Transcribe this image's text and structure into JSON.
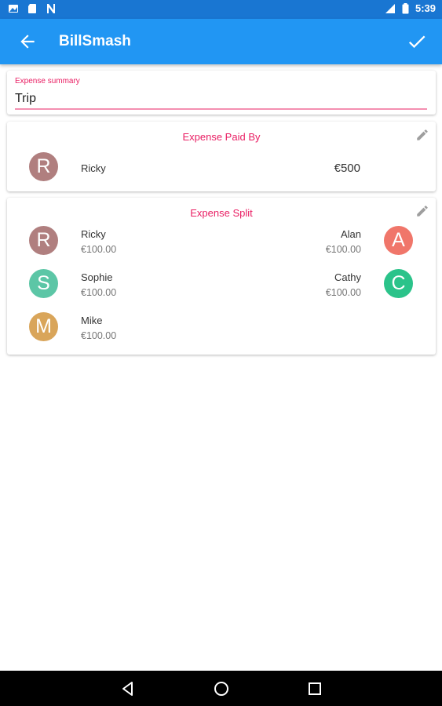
{
  "status": {
    "time": "5:39"
  },
  "appbar": {
    "title": "BillSmash"
  },
  "summary": {
    "label": "Expense summary",
    "value": "Trip"
  },
  "paid_by": {
    "header": "Expense Paid By",
    "person": {
      "initial": "R",
      "name": "Ricky",
      "amount": "€500",
      "color": "#B07F7F"
    }
  },
  "split": {
    "header": "Expense Split",
    "people": [
      {
        "initial": "R",
        "name": "Ricky",
        "amount": "€100.00",
        "color": "#B07F7F"
      },
      {
        "initial": "A",
        "name": "Alan",
        "amount": "€100.00",
        "color": "#F0766A"
      },
      {
        "initial": "S",
        "name": "Sophie",
        "amount": "€100.00",
        "color": "#5CC6A6"
      },
      {
        "initial": "C",
        "name": "Cathy",
        "amount": "€100.00",
        "color": "#2BC38A"
      },
      {
        "initial": "M",
        "name": "Mike",
        "amount": "€100.00",
        "color": "#D9A55A"
      }
    ]
  },
  "colors": {
    "primary": "#2196F3",
    "primary_dark": "#1976D2",
    "accent": "#E91E63"
  }
}
